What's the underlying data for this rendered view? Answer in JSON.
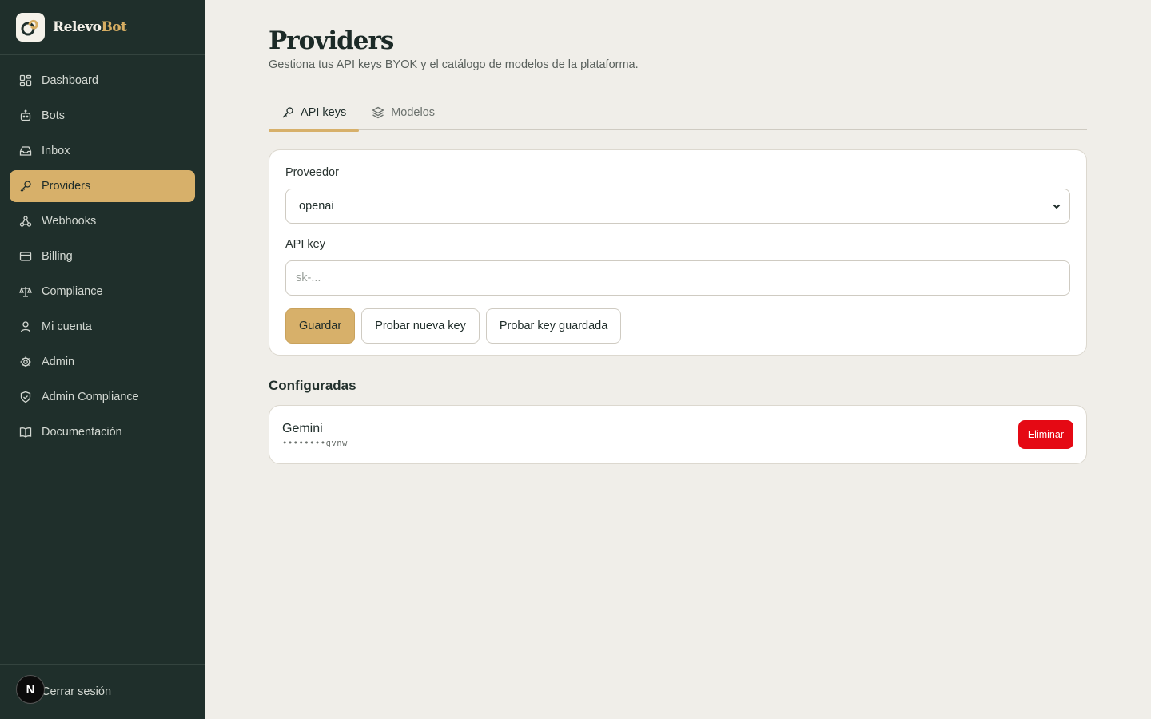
{
  "brand": {
    "name_part1": "Relevo",
    "name_part2": "Bot",
    "accent_color": "#d6ad62"
  },
  "sidebar": {
    "items": [
      {
        "label": "Dashboard",
        "icon": "dashboard-grid-icon"
      },
      {
        "label": "Bots",
        "icon": "bot-icon"
      },
      {
        "label": "Inbox",
        "icon": "inbox-icon"
      },
      {
        "label": "Providers",
        "icon": "key-icon",
        "active": true
      },
      {
        "label": "Webhooks",
        "icon": "webhook-icon"
      },
      {
        "label": "Billing",
        "icon": "credit-card-icon"
      },
      {
        "label": "Compliance",
        "icon": "scale-icon"
      },
      {
        "label": "Mi cuenta",
        "icon": "user-icon"
      },
      {
        "label": "Admin",
        "icon": "gear-icon"
      },
      {
        "label": "Admin Compliance",
        "icon": "shield-check-icon"
      },
      {
        "label": "Documentación",
        "icon": "book-icon"
      }
    ],
    "logout_label": "Cerrar sesión",
    "avatar_letter": "N"
  },
  "page": {
    "title": "Providers",
    "subtitle": "Gestiona tus API keys BYOK y el catálogo de modelos de la plataforma."
  },
  "tabs": [
    {
      "label": "API keys",
      "icon": "key-icon",
      "active": true
    },
    {
      "label": "Modelos",
      "icon": "layers-icon",
      "active": false
    }
  ],
  "form": {
    "provider_label": "Proveedor",
    "provider_value": "openai",
    "api_key_label": "API key",
    "api_key_placeholder": "sk-...",
    "api_key_value": "",
    "save_label": "Guardar",
    "test_new_label": "Probar nueva key",
    "test_saved_label": "Probar key guardada"
  },
  "configured": {
    "title": "Configuradas",
    "items": [
      {
        "name": "Gemini",
        "masked_key": "••••••••gvnw",
        "delete_label": "Eliminar"
      }
    ]
  },
  "colors": {
    "sidebar_bg": "#1f2f2b",
    "accent": "#d7b06a",
    "danger": "#e50914",
    "page_bg": "#f0eee9"
  }
}
